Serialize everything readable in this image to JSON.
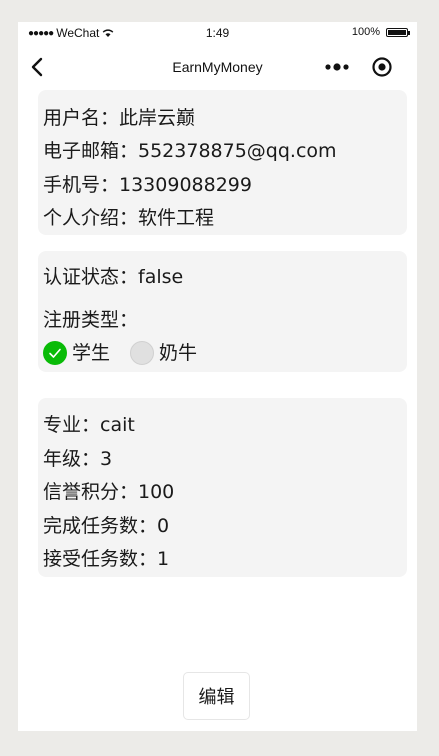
{
  "status_bar": {
    "carrier": "WeChat",
    "time": "1:49",
    "battery": "100%"
  },
  "nav": {
    "title": "EarnMyMoney"
  },
  "profile": {
    "username": "用户名：此岸云巅",
    "email": "电子邮箱：552378875@qq.com",
    "phone": "手机号：13309088299",
    "intro": "个人介绍：软件工程"
  },
  "registration": {
    "auth_status": "认证状态：false",
    "type_label": "注册类型：",
    "options": [
      {
        "label": "学生",
        "checked": true
      },
      {
        "label": "奶牛",
        "checked": false
      }
    ]
  },
  "student_info": {
    "major": "专业：cait",
    "grade": "年级：3",
    "credit": "信誉积分：100",
    "completed": "完成任务数：0",
    "accepted": "接受任务数：1"
  },
  "actions": {
    "edit_label": "编辑"
  },
  "colors": {
    "accent_green": "#09bb07",
    "card_bg": "#f4f4f4"
  }
}
